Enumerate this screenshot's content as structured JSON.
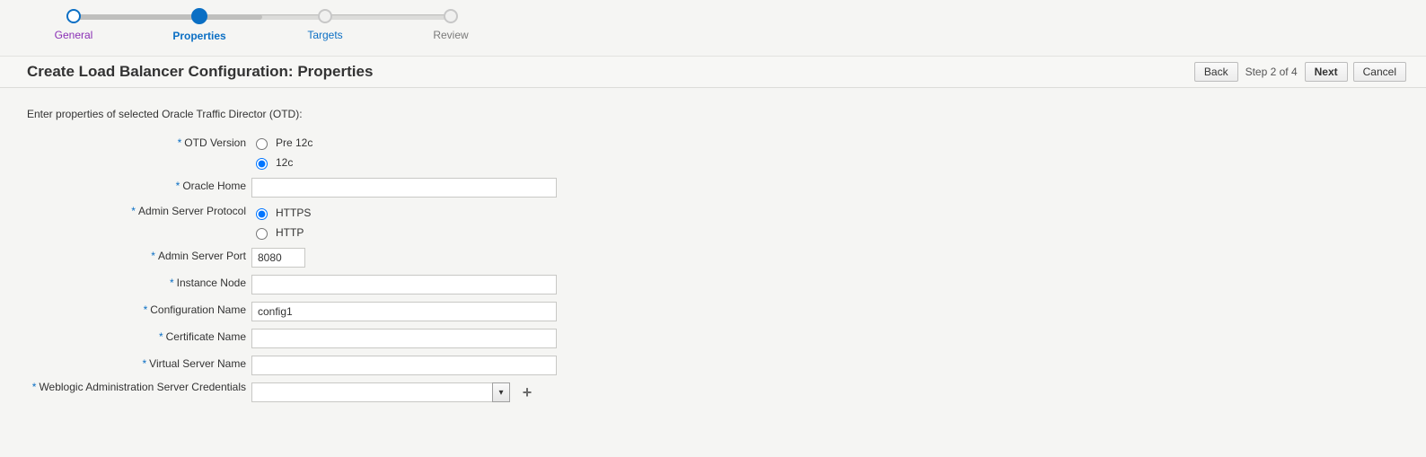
{
  "wizard": {
    "steps": [
      {
        "label": "General",
        "state": "done"
      },
      {
        "label": "Properties",
        "state": "current"
      },
      {
        "label": "Targets",
        "state": "link"
      },
      {
        "label": "Review",
        "state": "disabled"
      }
    ]
  },
  "header": {
    "title": "Create Load Balancer Configuration: Properties",
    "back": "Back",
    "next": "Next",
    "cancel": "Cancel",
    "step_text": "Step 2 of 4"
  },
  "intro": "Enter properties of selected Oracle Traffic Director (OTD):",
  "form": {
    "otd_version": {
      "label": "OTD Version",
      "options": [
        "Pre 12c",
        "12c"
      ],
      "selected": "12c"
    },
    "oracle_home": {
      "label": "Oracle Home",
      "value": ""
    },
    "admin_protocol": {
      "label": "Admin Server Protocol",
      "options": [
        "HTTPS",
        "HTTP"
      ],
      "selected": "HTTPS"
    },
    "admin_port": {
      "label": "Admin Server Port",
      "value": "8080"
    },
    "instance_node": {
      "label": "Instance Node",
      "value": ""
    },
    "config_name": {
      "label": "Configuration Name",
      "value": "config1"
    },
    "cert_name": {
      "label": "Certificate Name",
      "value": ""
    },
    "vserver_name": {
      "label": "Virtual Server Name",
      "value": ""
    },
    "wls_creds": {
      "label": "Weblogic Administration Server Credentials",
      "value": ""
    }
  }
}
